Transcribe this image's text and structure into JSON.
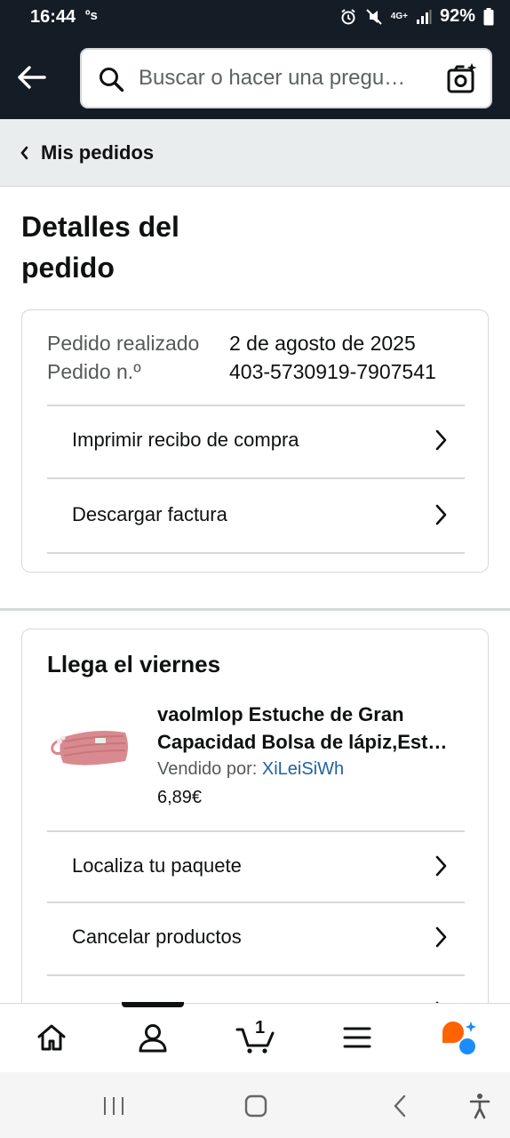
{
  "status_bar": {
    "time": "16:44",
    "extra": "ºs",
    "network": "4G+",
    "battery": "92%"
  },
  "header": {
    "search_placeholder": "Buscar o hacer una pregu…"
  },
  "breadcrumb": {
    "label": "Mis pedidos"
  },
  "page": {
    "title_line1": "Detalles del",
    "title_line2": "pedido"
  },
  "order": {
    "placed_label": "Pedido realizado",
    "placed_value": "2 de agosto de 2025",
    "number_label": "Pedido n.º",
    "number_value": "403-5730919-7907541",
    "actions": [
      {
        "label": "Imprimir recibo de compra"
      },
      {
        "label": "Descargar factura"
      }
    ]
  },
  "shipment": {
    "title": "Llega el viernes",
    "product": {
      "title_line1": "vaolmlop Estuche de Gran",
      "title_line2": "Capacidad Bolsa de lápiz,Est…",
      "sold_by_label": "Vendido por: ",
      "seller": "XiLeiSiWh",
      "price": "6,89€"
    },
    "actions": [
      {
        "label": "Localiza tu paquete"
      },
      {
        "label": "Cancelar productos"
      }
    ]
  },
  "bottom_nav": {
    "cart_count": "1",
    "items": [
      "home-icon",
      "account-icon",
      "cart-icon",
      "menu-icon",
      "rufus-ai-icon"
    ]
  },
  "colors": {
    "header_bg": "#141c26",
    "link_blue": "#2162a1",
    "product_pink": "#d98a8f",
    "ai_orange": "#ff6200",
    "ai_blue": "#1a8cff"
  }
}
